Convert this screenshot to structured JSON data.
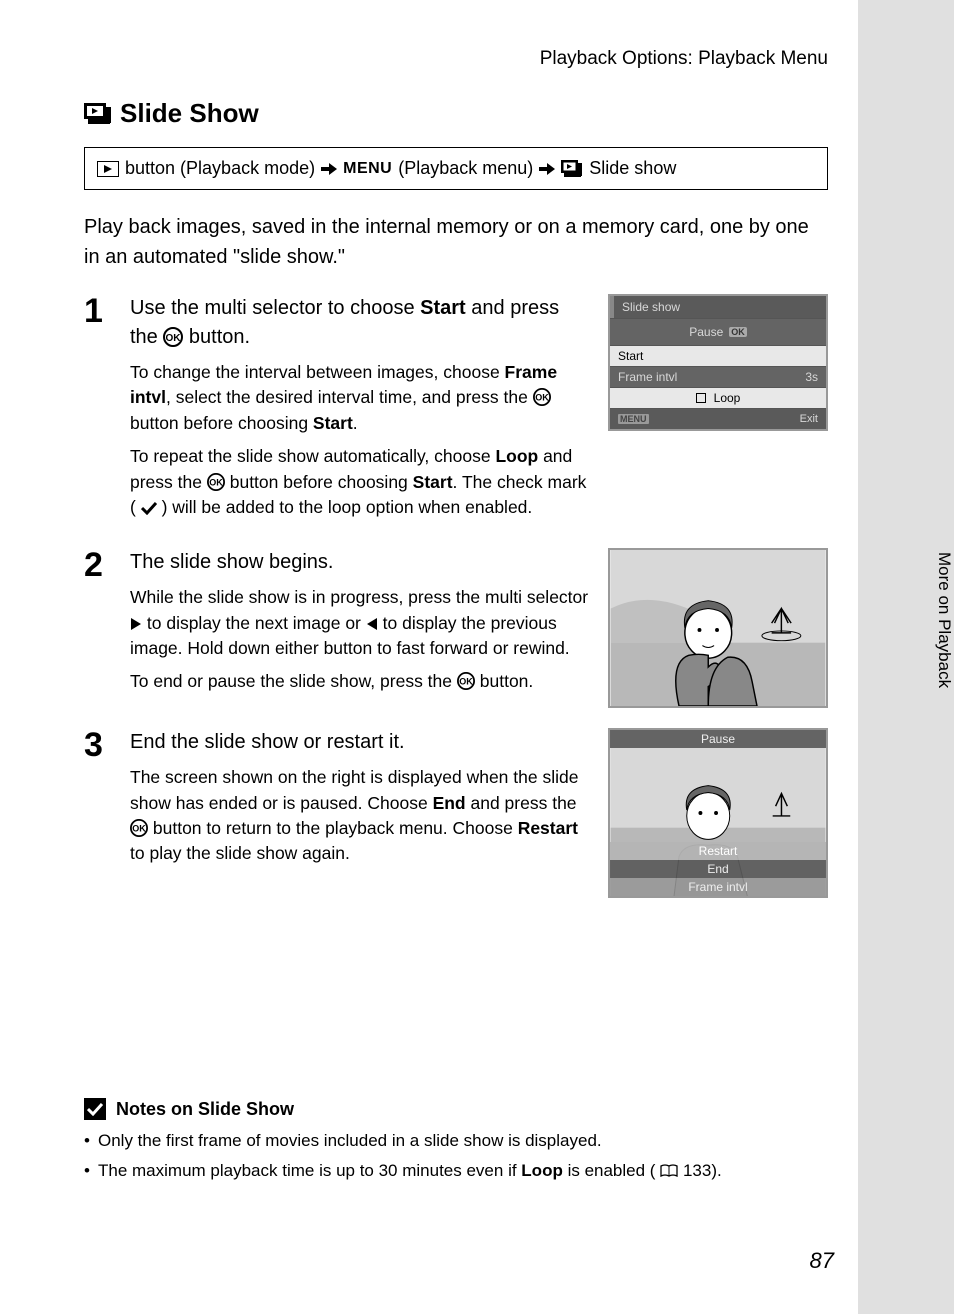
{
  "header": "Playback Options: Playback Menu",
  "tab_text": "More on Playback",
  "title": "Slide Show",
  "breadcrumb": {
    "b1": "button (Playback mode)",
    "menu": "MENU",
    "b2": "(Playback menu)",
    "b3": "Slide show"
  },
  "intro": "Play back images, saved in the internal memory or on a memory card, one by one in an automated \"slide show.\"",
  "steps": {
    "s1": {
      "num": "1",
      "title_pre": "Use the multi selector to choose ",
      "title_bold": "Start",
      "title_post": " and press the ",
      "title_end": " button.",
      "p1a": "To change the interval between images, choose ",
      "p1b1": "Frame intvl",
      "p1c": ", select the desired interval time, and press the ",
      "p1d": " button before choosing ",
      "p1b2": "Start",
      "p1e": ".",
      "p2a": "To repeat the slide show automatically, choose ",
      "p2b1": "Loop",
      "p2c": " and press the ",
      "p2d": " button before choosing ",
      "p2b2": "Start",
      "p2e": ". The check mark (",
      "p2f": ") will be added to the loop option when enabled."
    },
    "s2": {
      "num": "2",
      "title": "The slide show begins.",
      "p1a": "While the slide show is in progress, press the multi selector ",
      "p1b": " to display the next image or ",
      "p1c": " to display the previous image. Hold down either button to fast forward or rewind.",
      "p2a": "To end or pause the slide show, press the ",
      "p2b": " button."
    },
    "s3": {
      "num": "3",
      "title": "End the slide show or restart it.",
      "p1a": "The screen shown on the right is displayed when the slide show has ended or is paused. Choose ",
      "p1b1": "End",
      "p1c": " and press the ",
      "p1d": " button to return to the playback menu. Choose ",
      "p1b2": "Restart",
      "p1e": " to play the slide show again."
    }
  },
  "lcd1": {
    "title": "Slide show",
    "pause": "Pause",
    "start": "Start",
    "frame": "Frame intvl",
    "frame_val": "3s",
    "loop": "Loop",
    "exit": "Exit"
  },
  "lcd2": {
    "pause": "Pause",
    "restart": "Restart",
    "end": "End",
    "frame": "Frame intvl"
  },
  "notes": {
    "title": "Notes on Slide Show",
    "n1": "Only the first frame of movies included in a slide show is displayed.",
    "n2a": "The maximum playback time is up to 30 minutes even if ",
    "n2b": "Loop",
    "n2c": " is enabled (",
    "n2ref": "133",
    "n2d": ")."
  },
  "page_number": "87"
}
